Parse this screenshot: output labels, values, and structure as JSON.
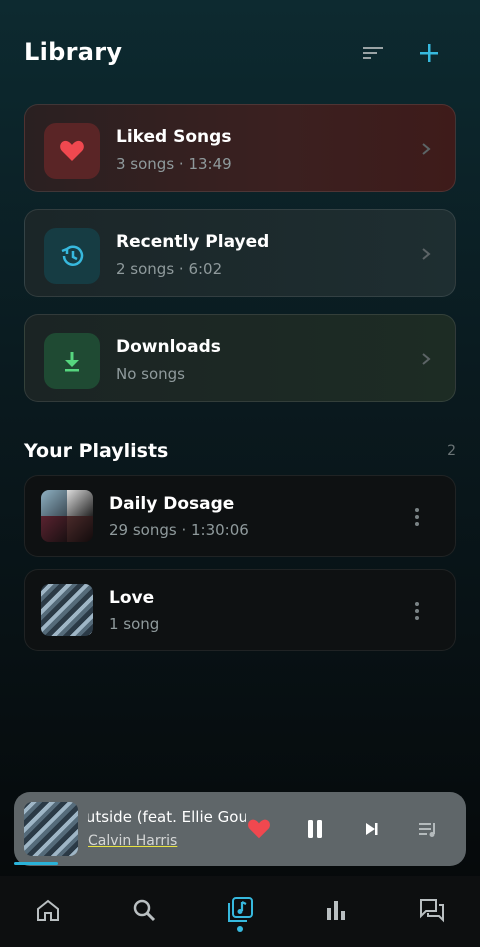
{
  "header": {
    "title": "Library"
  },
  "quick": [
    {
      "title": "Liked Songs",
      "subtitle": "3 songs · 13:49",
      "icon": "heart-icon"
    },
    {
      "title": "Recently Played",
      "subtitle": "2 songs · 6:02",
      "icon": "history-icon"
    },
    {
      "title": "Downloads",
      "subtitle": "No songs",
      "icon": "download-icon"
    }
  ],
  "playlists_section": {
    "title": "Your Playlists",
    "count": "2"
  },
  "playlists": [
    {
      "title": "Daily Dosage",
      "subtitle": "29 songs · 1:30:06"
    },
    {
      "title": "Love",
      "subtitle": "1 song"
    }
  ],
  "now_playing": {
    "title": "Outside (feat. Ellie Goulding)",
    "artist": "Calvin Harris",
    "progress": 0.1
  },
  "colors": {
    "accent": "#37b9de",
    "heart": "#f0484f",
    "download": "#56d67f"
  },
  "nav": [
    "home-icon",
    "search-icon",
    "library-icon",
    "stats-icon",
    "chat-icon"
  ]
}
